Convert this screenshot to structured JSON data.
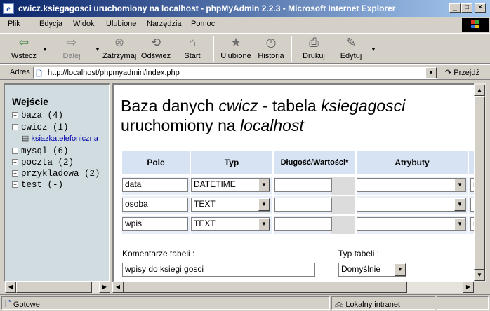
{
  "window": {
    "title": "cwicz.ksiegagosci uruchomiony na localhost - phpMyAdmin 2.2.3 - Microsoft Internet Explorer",
    "minimize": "_",
    "maximize": "□",
    "close": "×"
  },
  "menu": [
    "Plik",
    "Edycja",
    "Widok",
    "Ulubione",
    "Narzędzia",
    "Pomoc"
  ],
  "toolbar": {
    "back": "Wstecz",
    "forward": "Dalej",
    "stop": "Zatrzymaj",
    "refresh": "Odśwież",
    "home": "Start",
    "favorites": "Ulubione",
    "history": "Historia",
    "print": "Drukuj",
    "edit": "Edytuj"
  },
  "address": {
    "label": "Adres",
    "url": "http://localhost/phpmyadmin/index.php",
    "go": "Przejdź"
  },
  "sidebar": {
    "header": "Wejście",
    "databases": [
      {
        "name": "baza",
        "count": "(4)",
        "expanded": false
      },
      {
        "name": "cwicz",
        "count": "(1)",
        "expanded": true
      },
      {
        "name": "mysql",
        "count": "(6)",
        "expanded": false
      },
      {
        "name": "poczta",
        "count": "(2)",
        "expanded": false
      },
      {
        "name": "przykladowa",
        "count": "(2)",
        "expanded": false
      },
      {
        "name": "test",
        "count": "(-)",
        "expanded": true
      }
    ],
    "subitem": "ksiazkatelefoniczna"
  },
  "main": {
    "title_part1": "Baza danych ",
    "db_name": "cwicz",
    "title_part2": " - tabela ",
    "table_name": "ksiegagosci",
    "title_part3": "uruchomiony na ",
    "host": "localhost",
    "columns": [
      "Pole",
      "Typ",
      "Długość/Wartości*",
      "Atrybuty"
    ],
    "rows": [
      {
        "field": "data",
        "type": "DATETIME",
        "length": "",
        "attr": ""
      },
      {
        "field": "osoba",
        "type": "TEXT",
        "length": "",
        "attr": ""
      },
      {
        "field": "wpis",
        "type": "TEXT",
        "length": "",
        "attr": ""
      }
    ],
    "comment_label": "Komentarze tabeli :",
    "comment_value": "wpisy do ksiegi gosci",
    "table_type_label": "Typ tabeli :",
    "table_type_value": "Domyślnie"
  },
  "status": {
    "left": "Gotowe",
    "zone": "Lokalny intranet"
  }
}
